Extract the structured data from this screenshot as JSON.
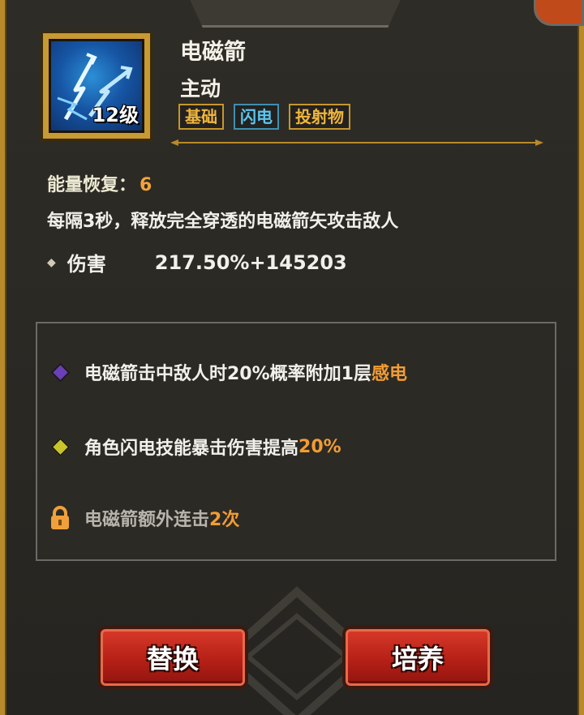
{
  "skill": {
    "name": "电磁箭",
    "type": "主动",
    "level_badge": "12级",
    "tags": [
      {
        "label": "基础",
        "color": "#f0b63a"
      },
      {
        "label": "闪电",
        "color": "#5cc6ee"
      },
      {
        "label": "投射物",
        "color": "#f0b63a"
      }
    ]
  },
  "energy": {
    "label": "能量恢复：",
    "value": "6"
  },
  "description": "每隔3秒，释放完全穿透的电磁箭矢攻击敌人",
  "damage": {
    "label": "伤害",
    "value": "217.50%+145203"
  },
  "effects": [
    {
      "icon": "purple-diamond-icon",
      "text": "电磁箭击中敌人时20%概率附加1层",
      "highlight": "感电",
      "color": "#6a3fb8"
    },
    {
      "icon": "yellow-diamond-icon",
      "text": "角色闪电技能暴击伤害提高",
      "highlight": "20%",
      "color": "#c8c42a"
    },
    {
      "icon": "lock-icon",
      "text": "电磁箭额外连击",
      "highlight": "2次",
      "color": "#f0a03a"
    }
  ],
  "buttons": {
    "replace": "替换",
    "cultivate": "培养"
  },
  "colors": {
    "accent_orange": "#f29c34",
    "button_red": "#c42a1c",
    "frame_gold": "#b88a2a"
  }
}
